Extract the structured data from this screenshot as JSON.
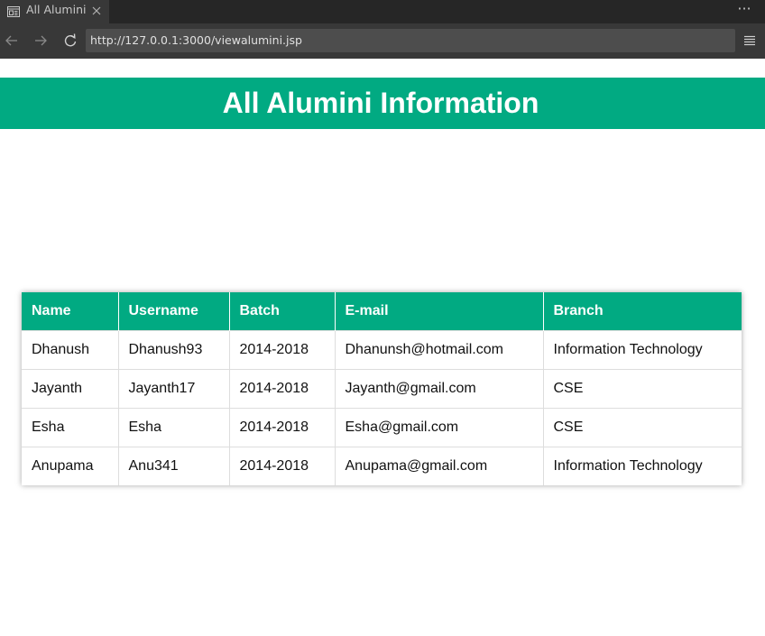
{
  "browser": {
    "tab_title": "All Alumini",
    "url": "http://127.0.0.1:3000/viewalumini.jsp",
    "menu_dots": "···"
  },
  "page": {
    "title": "All Alumini Information"
  },
  "table": {
    "headers": [
      "Name",
      "Username",
      "Batch",
      "E-mail",
      "Branch"
    ],
    "rows": [
      [
        "Dhanush",
        "Dhanush93",
        "2014-2018",
        "Dhanunsh@hotmail.com",
        "Information Technology"
      ],
      [
        "Jayanth",
        "Jayanth17",
        "2014-2018",
        "Jayanth@gmail.com",
        "CSE"
      ],
      [
        "Esha",
        "Esha",
        "2014-2018",
        "Esha@gmail.com",
        "CSE"
      ],
      [
        "Anupama",
        "Anu341",
        "2014-2018",
        "Anupama@gmail.com",
        "Information Technology"
      ]
    ]
  },
  "colors": {
    "accent": "#01aa82",
    "browser_dark": "#262626",
    "browser_toolbar": "#383838"
  }
}
